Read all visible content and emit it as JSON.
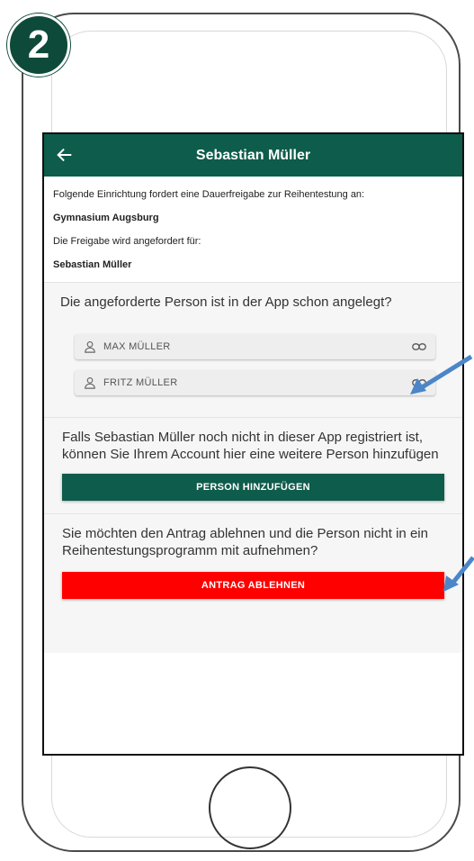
{
  "step_badge": "2",
  "appbar": {
    "title": "Sebastian Müller",
    "back_icon": "arrow-left-icon"
  },
  "info": {
    "line1": "Folgende Einrichtung fordert eine Dauerfreigabe zur Reihentestung an:",
    "institution": "Gymnasium Augsburg",
    "line2": "Die Freigabe wird angefordert für:",
    "person": "Sebastian Müller"
  },
  "existing_section": {
    "question": "Die angeforderte Person ist in der App schon angelegt?",
    "persons": [
      {
        "name": "MAX MÜLLER",
        "icon": "person-icon",
        "action_icon": "link-icon"
      },
      {
        "name": "FRITZ MÜLLER",
        "icon": "person-icon",
        "action_icon": "link-icon"
      }
    ]
  },
  "add_section": {
    "text": "Falls Sebastian Müller noch nicht in dieser App registriert ist, können Sie Ihrem Account hier eine weitere Person hinzufügen",
    "button_label": "PERSON HINZUFÜGEN"
  },
  "reject_section": {
    "text": "Sie möchten den Antrag ablehnen und die Person nicht in ein Reihentestungsprogramm mit aufnehmen?",
    "button_label": "ANTRAG ABLEHNEN"
  },
  "colors": {
    "primary": "#0e5c4b",
    "badge": "#0e4a3a",
    "danger": "#ff0000",
    "arrow": "#4a86c8"
  }
}
